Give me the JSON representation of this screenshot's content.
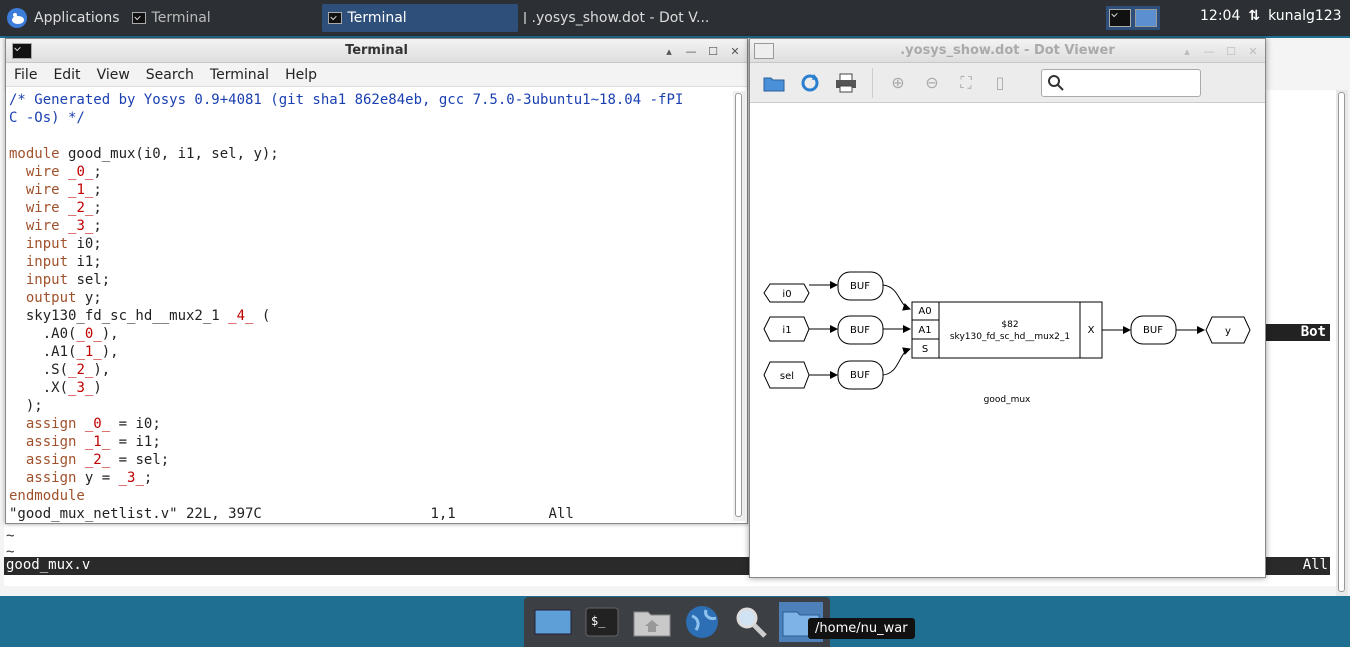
{
  "panel": {
    "apps_label": "Applications",
    "tasks": [
      "Terminal",
      "Terminal",
      ".yosys_show.dot - Dot V..."
    ],
    "clock": "12:04",
    "user": "kunalg123"
  },
  "background_editor": {
    "tilde_lines": [
      "~",
      "~"
    ],
    "status_right_marker": "Bot",
    "status_file": "good_mux.v",
    "status_right": "All"
  },
  "terminal": {
    "title": "Terminal",
    "menu": [
      "File",
      "Edit",
      "View",
      "Search",
      "Terminal",
      "Help"
    ],
    "comment1": "/* Generated by Yosys 0.9+4081 (git sha1 862e84eb, gcc 7.5.0-3ubuntu1~18.04 -fPI",
    "comment2": "C -Os) */",
    "status_file": "\"good_mux_netlist.v\" 22L, 397C",
    "status_pos": "1,1",
    "status_all": "All"
  },
  "dot_viewer": {
    "title": ".yosys_show.dot - Dot Viewer",
    "graph": {
      "inputs": [
        "i0",
        "i1",
        "sel"
      ],
      "buf_label": "BUF",
      "cell_pins": [
        "A0",
        "A1",
        "S"
      ],
      "cell_out_pin": "X",
      "cell_id": "$82",
      "cell_type": "sky130_fd_sc_hd__mux2_1",
      "output": "y",
      "module_name": "good_mux"
    }
  },
  "dock": {
    "tooltip": "/home/nu_war"
  }
}
